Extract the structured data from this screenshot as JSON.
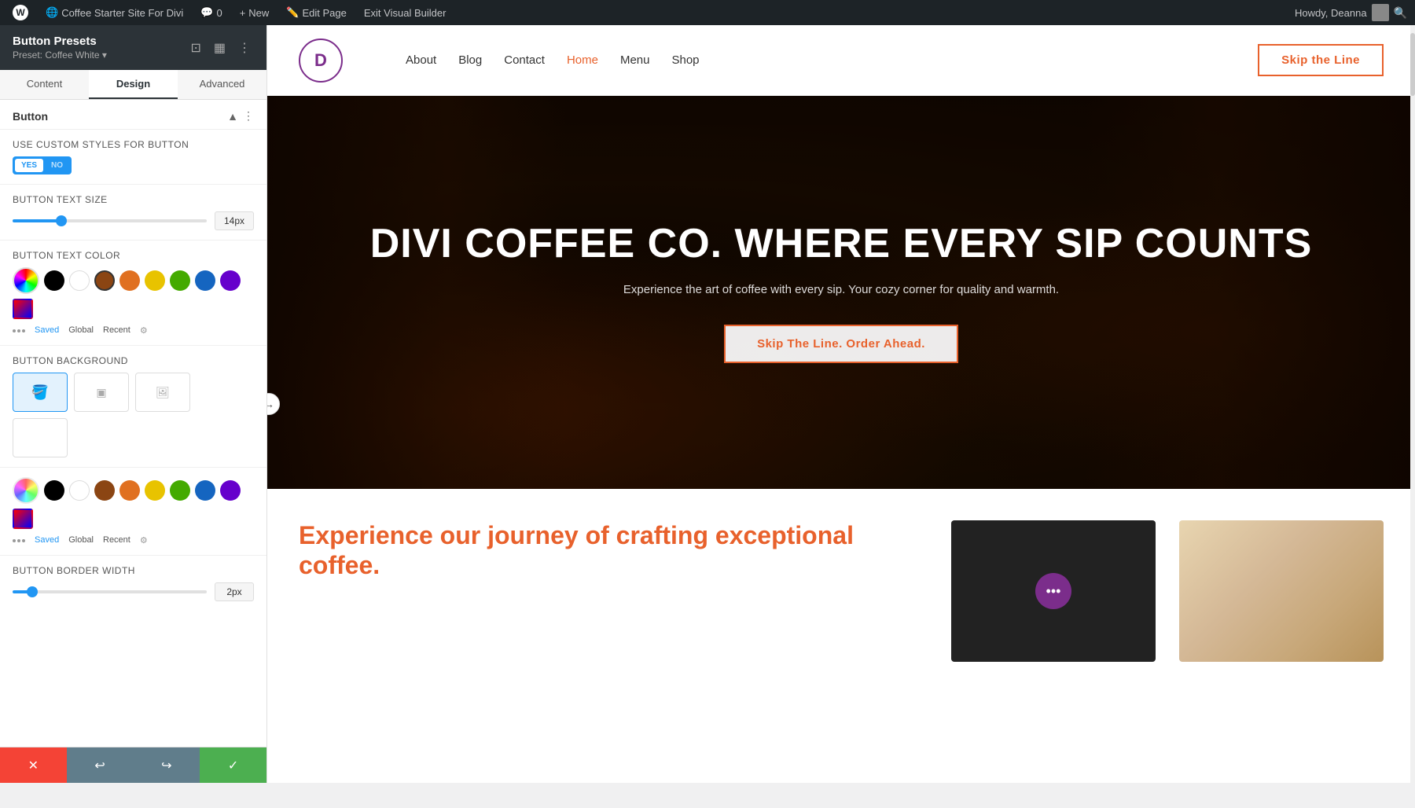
{
  "adminBar": {
    "wpLogoLabel": "W",
    "siteTitle": "Coffee Starter Site For Divi",
    "commentsCount": "0",
    "newLabel": "New",
    "editPageLabel": "Edit Page",
    "exitBuilderLabel": "Exit Visual Builder",
    "howdyLabel": "Howdy, Deanna",
    "searchIcon": "search-icon"
  },
  "panel": {
    "title": "Button Presets",
    "preset": "Preset: Coffee White ▾",
    "tabs": [
      {
        "id": "content",
        "label": "Content"
      },
      {
        "id": "design",
        "label": "Design"
      },
      {
        "id": "advanced",
        "label": "Advanced"
      }
    ],
    "activeTab": "design",
    "sectionTitle": "Button",
    "toggleLabel": "Use Custom Styles For Button",
    "toggleYes": "YES",
    "toggleNo": "NO",
    "textSizeLabel": "Button Text Size",
    "textSizeValue": "14px",
    "textColorLabel": "Button Text Color",
    "colorLabels": {
      "saved": "Saved",
      "global": "Global",
      "recent": "Recent"
    },
    "bgLabel": "Button Background",
    "bgColorSection": {
      "colorLabels": {
        "saved": "Saved",
        "global": "Global",
        "recent": "Recent"
      }
    },
    "borderWidthLabel": "Button Border Width",
    "borderWidthValue": "2px",
    "toolbar": {
      "cancelLabel": "✕",
      "undoLabel": "↩",
      "redoLabel": "↪",
      "saveLabel": "✓"
    }
  },
  "site": {
    "logoLetter": "D",
    "nav": {
      "links": [
        "About",
        "Blog",
        "Contact",
        "Home",
        "Menu",
        "Shop"
      ],
      "activeLink": "Home",
      "ctaLabel": "Skip the Line"
    },
    "hero": {
      "title": "DIVI COFFEE CO. WHERE EVERY SIP COUNTS",
      "subtitle": "Experience the art of coffee with every sip. Your cozy corner for quality and warmth.",
      "ctaLabel": "Skip The Line. Order Ahead."
    },
    "belowHero": {
      "title": "Experience our journey of crafting exceptional coffee."
    }
  },
  "colors": {
    "orange": "#e8612c",
    "black": "#000000",
    "white": "#ffffff",
    "brown": "#8B4513",
    "darkOrange": "#cc5500",
    "yellow": "#e8c300",
    "green": "#44aa00",
    "blue": "#1565c0",
    "purple": "#6600cc"
  }
}
